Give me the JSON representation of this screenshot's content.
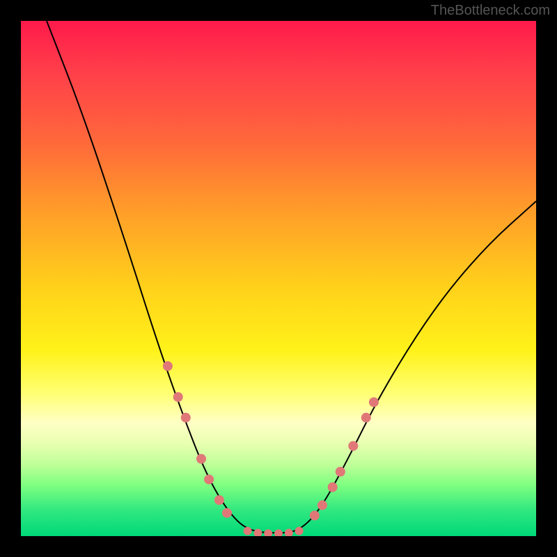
{
  "watermark": "TheBottleneck.com",
  "chart_data": {
    "type": "line",
    "title": "",
    "xlabel": "",
    "ylabel": "",
    "xlim": [
      0,
      100
    ],
    "ylim": [
      0,
      100
    ],
    "curve": {
      "description": "V-shaped bottleneck curve descending from top-left, reaching a flat minimum near center-bottom, rising to right edge",
      "points": [
        {
          "x": 5,
          "y": 100
        },
        {
          "x": 12,
          "y": 82
        },
        {
          "x": 20,
          "y": 58
        },
        {
          "x": 27,
          "y": 36
        },
        {
          "x": 32,
          "y": 22
        },
        {
          "x": 36,
          "y": 12
        },
        {
          "x": 40,
          "y": 5
        },
        {
          "x": 44,
          "y": 1
        },
        {
          "x": 50,
          "y": 0.5
        },
        {
          "x": 54,
          "y": 1
        },
        {
          "x": 58,
          "y": 5
        },
        {
          "x": 63,
          "y": 14
        },
        {
          "x": 70,
          "y": 28
        },
        {
          "x": 80,
          "y": 44
        },
        {
          "x": 90,
          "y": 56
        },
        {
          "x": 100,
          "y": 65
        }
      ]
    },
    "markers_left": [
      {
        "x": 28.5,
        "y": 33
      },
      {
        "x": 30.5,
        "y": 27
      },
      {
        "x": 32,
        "y": 23
      },
      {
        "x": 35,
        "y": 15
      },
      {
        "x": 36.5,
        "y": 11
      },
      {
        "x": 38.5,
        "y": 7
      },
      {
        "x": 40,
        "y": 4.5
      }
    ],
    "markers_bottom": [
      {
        "x": 44,
        "y": 1
      },
      {
        "x": 46,
        "y": 0.6
      },
      {
        "x": 48,
        "y": 0.5
      },
      {
        "x": 50,
        "y": 0.5
      },
      {
        "x": 52,
        "y": 0.6
      },
      {
        "x": 54,
        "y": 1
      }
    ],
    "markers_right": [
      {
        "x": 57,
        "y": 4
      },
      {
        "x": 58.5,
        "y": 6
      },
      {
        "x": 60.5,
        "y": 9.5
      },
      {
        "x": 62,
        "y": 12.5
      },
      {
        "x": 64.5,
        "y": 17.5
      },
      {
        "x": 67,
        "y": 23
      },
      {
        "x": 68.5,
        "y": 26
      }
    ],
    "marker_color": "#e07878",
    "curve_color": "#000000",
    "gradient_stops": [
      {
        "pos": 0,
        "color": "#ff1a4a"
      },
      {
        "pos": 50,
        "color": "#ffe020"
      },
      {
        "pos": 78,
        "color": "#ffffc5"
      },
      {
        "pos": 100,
        "color": "#00d878"
      }
    ]
  }
}
